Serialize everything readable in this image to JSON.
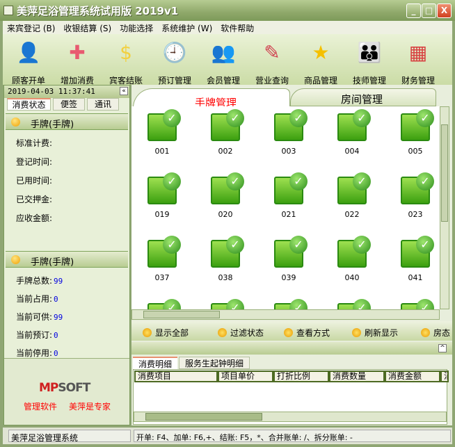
{
  "window": {
    "title": "美萍足浴管理系统试用版 2019v1",
    "minimize": "_",
    "maximize": "□",
    "close": "X"
  },
  "menu": [
    "来宾登记 (B)",
    "收银结算 (S)",
    "功能选择",
    "系统维护 (W)",
    "软件帮助"
  ],
  "toolbar": [
    {
      "label": "顾客开单",
      "icon": "user-icon",
      "glyph": "👤",
      "color": "#4caf3c"
    },
    {
      "label": "增加消费",
      "icon": "add-icon",
      "glyph": "✚",
      "color": "#e85a70"
    },
    {
      "label": "宾客结账",
      "icon": "dollar-arrow-icon",
      "glyph": "$",
      "color": "#f2d040"
    },
    {
      "label": "预订管理",
      "icon": "clock-icon",
      "glyph": "🕘",
      "color": "#e8d050"
    },
    {
      "label": "会员管理",
      "icon": "members-icon",
      "glyph": "👥",
      "color": "#e89040"
    },
    {
      "label": "营业查询",
      "icon": "notebook-icon",
      "glyph": "✎",
      "color": "#d04050"
    },
    {
      "label": "商品管理",
      "icon": "star-icon",
      "glyph": "★",
      "color": "#f5c000"
    },
    {
      "label": "技师管理",
      "icon": "group-icon",
      "glyph": "👪",
      "color": "#c85050"
    },
    {
      "label": "财务管理",
      "icon": "calculator-icon",
      "glyph": "▦",
      "color": "#d84040"
    }
  ],
  "left": {
    "datetime": "2019-04-03 11:37:41",
    "collapse": "«",
    "tabs": [
      "消费状态",
      "便签",
      "通讯"
    ],
    "section1": {
      "title": "手牌(手牌)",
      "fields": [
        "标准计费:",
        "登记时间:",
        "已用时间:",
        "已交押金:",
        "应收金额:"
      ]
    },
    "section2": {
      "title": "手牌(手牌)",
      "fields": [
        {
          "label": "手牌总数:",
          "value": "99"
        },
        {
          "label": "当前占用:",
          "value": "0"
        },
        {
          "label": "当前可供:",
          "value": "99"
        },
        {
          "label": "当前预订:",
          "value": "0"
        },
        {
          "label": "当前停用:",
          "value": "0"
        }
      ]
    },
    "logo": "MPSOFT",
    "slogan1": "管理软件",
    "slogan2": "美萍是专家"
  },
  "main": {
    "tabs": [
      "手牌管理",
      "房间管理"
    ],
    "rooms": [
      "001",
      "002",
      "003",
      "004",
      "005",
      "019",
      "020",
      "021",
      "022",
      "023",
      "037",
      "038",
      "039",
      "040",
      "041",
      "",
      "",
      "",
      "",
      ""
    ],
    "actions": [
      "显示全部",
      "过滤状态",
      "查看方式",
      "刷新显示",
      "房态"
    ],
    "detail_tabs": [
      "消费明细",
      "服务生起钟明细"
    ],
    "columns": [
      "消费项目",
      "项目单价",
      "打折比例",
      "消费数量",
      "消费金额",
      "消"
    ]
  },
  "status": {
    "left": "美萍足浴管理系统",
    "right": "开单: F4、加单: F6,+、结账: F5，*、合并账单: /、拆分账单: -"
  }
}
